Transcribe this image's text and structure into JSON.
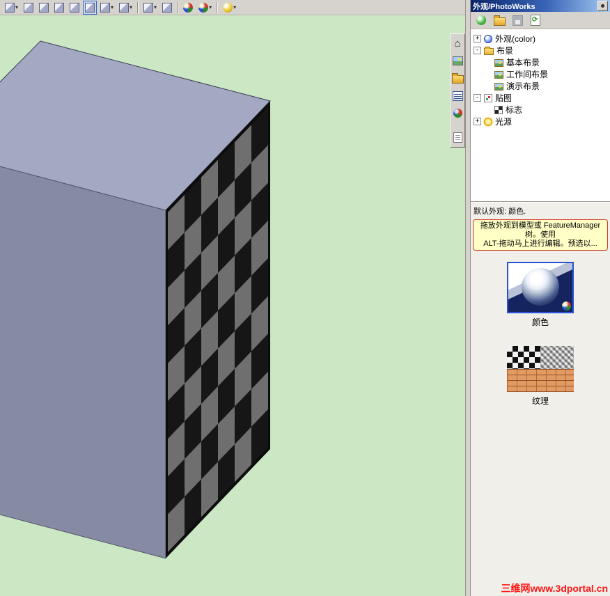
{
  "window": {
    "viewport_bg": "#cbe7c3"
  },
  "toolbar_top": {
    "items": [
      {
        "name": "view-orientation",
        "icon": "cube",
        "dropdown": true
      },
      {
        "name": "wireframe",
        "icon": "cube"
      },
      {
        "name": "hidden-lines-visible",
        "icon": "cube"
      },
      {
        "name": "hidden-lines-removed",
        "icon": "cube"
      },
      {
        "name": "shaded-with-edges",
        "icon": "cube"
      },
      {
        "name": "shaded",
        "icon": "cube",
        "pressed": true
      },
      {
        "name": "shadows-in-shaded-mode",
        "icon": "cube",
        "dropdown": true
      },
      {
        "name": "section-view",
        "icon": "cube",
        "dropdown": true
      },
      {
        "type": "separator"
      },
      {
        "name": "standard-views",
        "icon": "cube",
        "dropdown": true
      },
      {
        "name": "camera-views",
        "icon": "cube"
      },
      {
        "type": "separator"
      },
      {
        "name": "photoworks-render",
        "icon": "ball-rgb"
      },
      {
        "name": "photoworks-render-area",
        "icon": "ball-rgb",
        "dropdown": true
      },
      {
        "type": "separator"
      },
      {
        "name": "appearance-target",
        "icon": "ball-yellow",
        "dropdown": true
      }
    ]
  },
  "toolbar_side": {
    "items": [
      {
        "name": "photoworks-home",
        "icon": "home"
      },
      {
        "name": "photoworks-preview",
        "icon": "scene"
      },
      {
        "name": "photoworks-open",
        "icon": "folder"
      },
      {
        "name": "photoworks-layout",
        "icon": "layout"
      },
      {
        "name": "photoworks-colors",
        "icon": "colors"
      },
      {
        "type": "separator"
      },
      {
        "name": "photoworks-notes",
        "icon": "page"
      }
    ]
  },
  "panel": {
    "title": "外观/PhotoWorks",
    "toolbar": {
      "buttons": [
        {
          "name": "add-appearance",
          "icon": "ball-green"
        },
        {
          "name": "open-archive",
          "icon": "folder"
        },
        {
          "name": "save",
          "icon": "save",
          "disabled": true
        },
        {
          "name": "update-preview",
          "icon": "doc-refresh"
        }
      ]
    },
    "tree": {
      "items": [
        {
          "id": "appearance-color",
          "label": "外观(color)",
          "icon": "ball",
          "expander": "+",
          "level": 0
        },
        {
          "id": "scenes",
          "label": "布景",
          "icon": "scene-folder",
          "expander": "-",
          "level": 0
        },
        {
          "id": "basic-scenes",
          "label": "基本布景",
          "icon": "scene",
          "level": 1
        },
        {
          "id": "studio-scenes",
          "label": "工作间布景",
          "icon": "scene",
          "level": 1
        },
        {
          "id": "presentation-scenes",
          "label": "演示布景",
          "icon": "scene",
          "level": 1
        },
        {
          "id": "decals",
          "label": "贴图",
          "icon": "decal",
          "expander": "-",
          "level": 0
        },
        {
          "id": "logos",
          "label": "标志",
          "icon": "flag",
          "level": 1
        },
        {
          "id": "lights",
          "label": "光源",
          "icon": "light",
          "expander": "+",
          "level": 0
        }
      ]
    },
    "default_appearance_label": "默认外观: 颜色.",
    "note": {
      "lines": [
        "拖放外观到模型或 FeatureManager",
        "树。使用",
        "ALT-拖动马上进行编辑。预选以..."
      ]
    },
    "previews": [
      {
        "label": "颜色",
        "type": "sphere"
      },
      {
        "label": "纹理",
        "type": "texture"
      }
    ]
  },
  "model": {
    "top_color": "#a3a8c3",
    "left_color": "#868aa3",
    "edge_color": "#3a3d52",
    "checker": {
      "cols": 6,
      "rows": 9,
      "dark": "#161616",
      "light": "#6f6f6f",
      "frame": "#0c0c0c"
    }
  },
  "watermark": {
    "text": "三维网www.3dportal.cn",
    "color": "#ff1616"
  }
}
